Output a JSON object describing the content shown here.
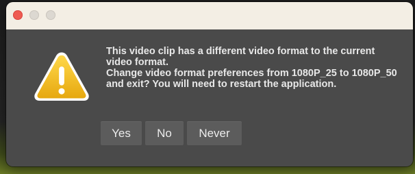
{
  "window": {
    "titlebar_color": "#f3eee4",
    "background_color": "#4a4a4a",
    "traffic_lights": {
      "close_color": "#ee5b52",
      "inactive_color": "#dcd8d1"
    }
  },
  "dialog": {
    "icon": "warning-icon",
    "icon_color": "#f0c020",
    "message_line_1": "This video clip has a different video format to the current video format.",
    "message_line_2": "Change video format preferences from 1080P_25 to 1080P_50 and exit? You will need to restart the application.",
    "buttons": {
      "yes_label": "Yes",
      "no_label": "No",
      "never_label": "Never"
    }
  }
}
